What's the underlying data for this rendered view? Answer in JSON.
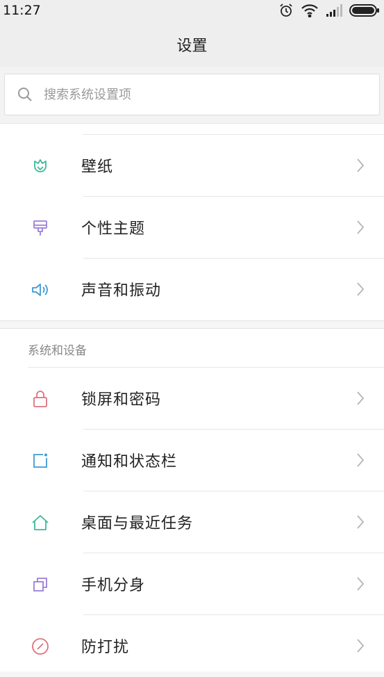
{
  "status_bar": {
    "time": "11:27",
    "icons": [
      "alarm-icon",
      "wifi-icon",
      "signal-icon",
      "battery-icon"
    ]
  },
  "header": {
    "title": "设置"
  },
  "search": {
    "placeholder": "搜索系统设置项"
  },
  "group1": {
    "items": [
      {
        "label": "壁纸",
        "icon": "wallpaper-icon",
        "color": "#3bb99b"
      },
      {
        "label": "个性主题",
        "icon": "theme-icon",
        "color": "#9b7fd6"
      },
      {
        "label": "声音和振动",
        "icon": "sound-icon",
        "color": "#3c9ad6"
      }
    ]
  },
  "group2": {
    "title": "系统和设备",
    "items": [
      {
        "label": "锁屏和密码",
        "icon": "lock-icon",
        "color": "#e0707e"
      },
      {
        "label": "通知和状态栏",
        "icon": "notification-icon",
        "color": "#3c9ad6"
      },
      {
        "label": "桌面与最近任务",
        "icon": "home-icon",
        "color": "#3bb99b"
      },
      {
        "label": "手机分身",
        "icon": "clone-icon",
        "color": "#9b7fd6"
      },
      {
        "label": "防打扰",
        "icon": "do-not-disturb-icon",
        "color": "#e0707e"
      }
    ]
  }
}
